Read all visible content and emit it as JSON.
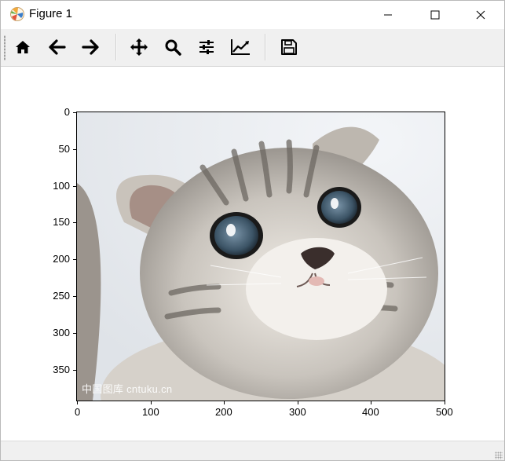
{
  "window": {
    "title": "Figure 1"
  },
  "titlebar_buttons": [
    {
      "name": "minimize",
      "icon": "minimize-icon"
    },
    {
      "name": "maximize",
      "icon": "maximize-icon"
    },
    {
      "name": "close",
      "icon": "close-icon"
    }
  ],
  "toolbar": {
    "items": [
      {
        "name": "home",
        "icon": "home-icon"
      },
      {
        "name": "back",
        "icon": "arrow-left-icon"
      },
      {
        "name": "forward",
        "icon": "arrow-right-icon"
      },
      {
        "name": "pan",
        "icon": "move-arrows-icon"
      },
      {
        "name": "zoom",
        "icon": "magnifier-icon"
      },
      {
        "name": "configure-subplots",
        "icon": "sliders-icon"
      },
      {
        "name": "edit-axes",
        "icon": "line-chart-icon"
      },
      {
        "name": "save",
        "icon": "floppy-disk-icon"
      }
    ]
  },
  "figure": {
    "image_description": "photo of a grey tabby kitten with blue eyes",
    "watermark": "中国图库 cntuku.cn",
    "y_ticks": [
      "0",
      "50",
      "100",
      "150",
      "200",
      "250",
      "300",
      "350"
    ],
    "x_ticks": [
      "0",
      "100",
      "200",
      "300",
      "400",
      "500"
    ],
    "xlim": [
      0,
      500
    ],
    "ylim": [
      0,
      392
    ]
  },
  "colors": {
    "toolbar_bg": "#f0f0f0",
    "icon": "#000000"
  }
}
